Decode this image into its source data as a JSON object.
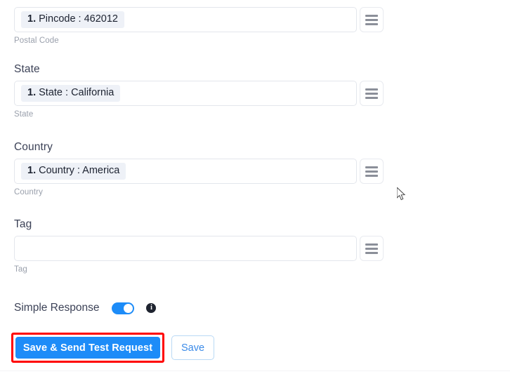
{
  "fields": [
    {
      "label": "",
      "has_label": false,
      "chip": "1. Pincode : 462012",
      "chip_number": "1.",
      "chip_text": "Pincode : 462012",
      "helper": "Postal Code",
      "menu_icon": "hamburger-icon",
      "value": "1. Pincode : 462012",
      "placeholder": ""
    },
    {
      "label": "State",
      "has_label": true,
      "chip": "1. State : California",
      "chip_number": "1.",
      "chip_text": "State : California",
      "helper": "State",
      "menu_icon": "hamburger-icon",
      "value": "1. State : California",
      "placeholder": ""
    },
    {
      "label": "Country",
      "has_label": true,
      "chip": "1. Country : America",
      "chip_number": "1.",
      "chip_text": "Country : America",
      "helper": "Country",
      "menu_icon": "hamburger-icon",
      "value": "1. Country : America",
      "placeholder": ""
    },
    {
      "label": "Tag",
      "has_label": true,
      "chip": "",
      "chip_number": "",
      "chip_text": "",
      "helper": "Tag",
      "menu_icon": "hamburger-icon",
      "value": "",
      "placeholder": ""
    }
  ],
  "toggle": {
    "label": "Simple Response",
    "state": "on",
    "info_icon": "info-icon",
    "info_glyph": "i"
  },
  "buttons": {
    "primary_label": "Save & Send Test Request",
    "secondary_label": "Save"
  },
  "colors": {
    "accent_blue": "#1d8cf8",
    "highlight_red": "#ff0000",
    "chip_bg": "#eef1f7",
    "secondary_text": "#3a8ae8",
    "helper_text": "#9aa0ac"
  }
}
